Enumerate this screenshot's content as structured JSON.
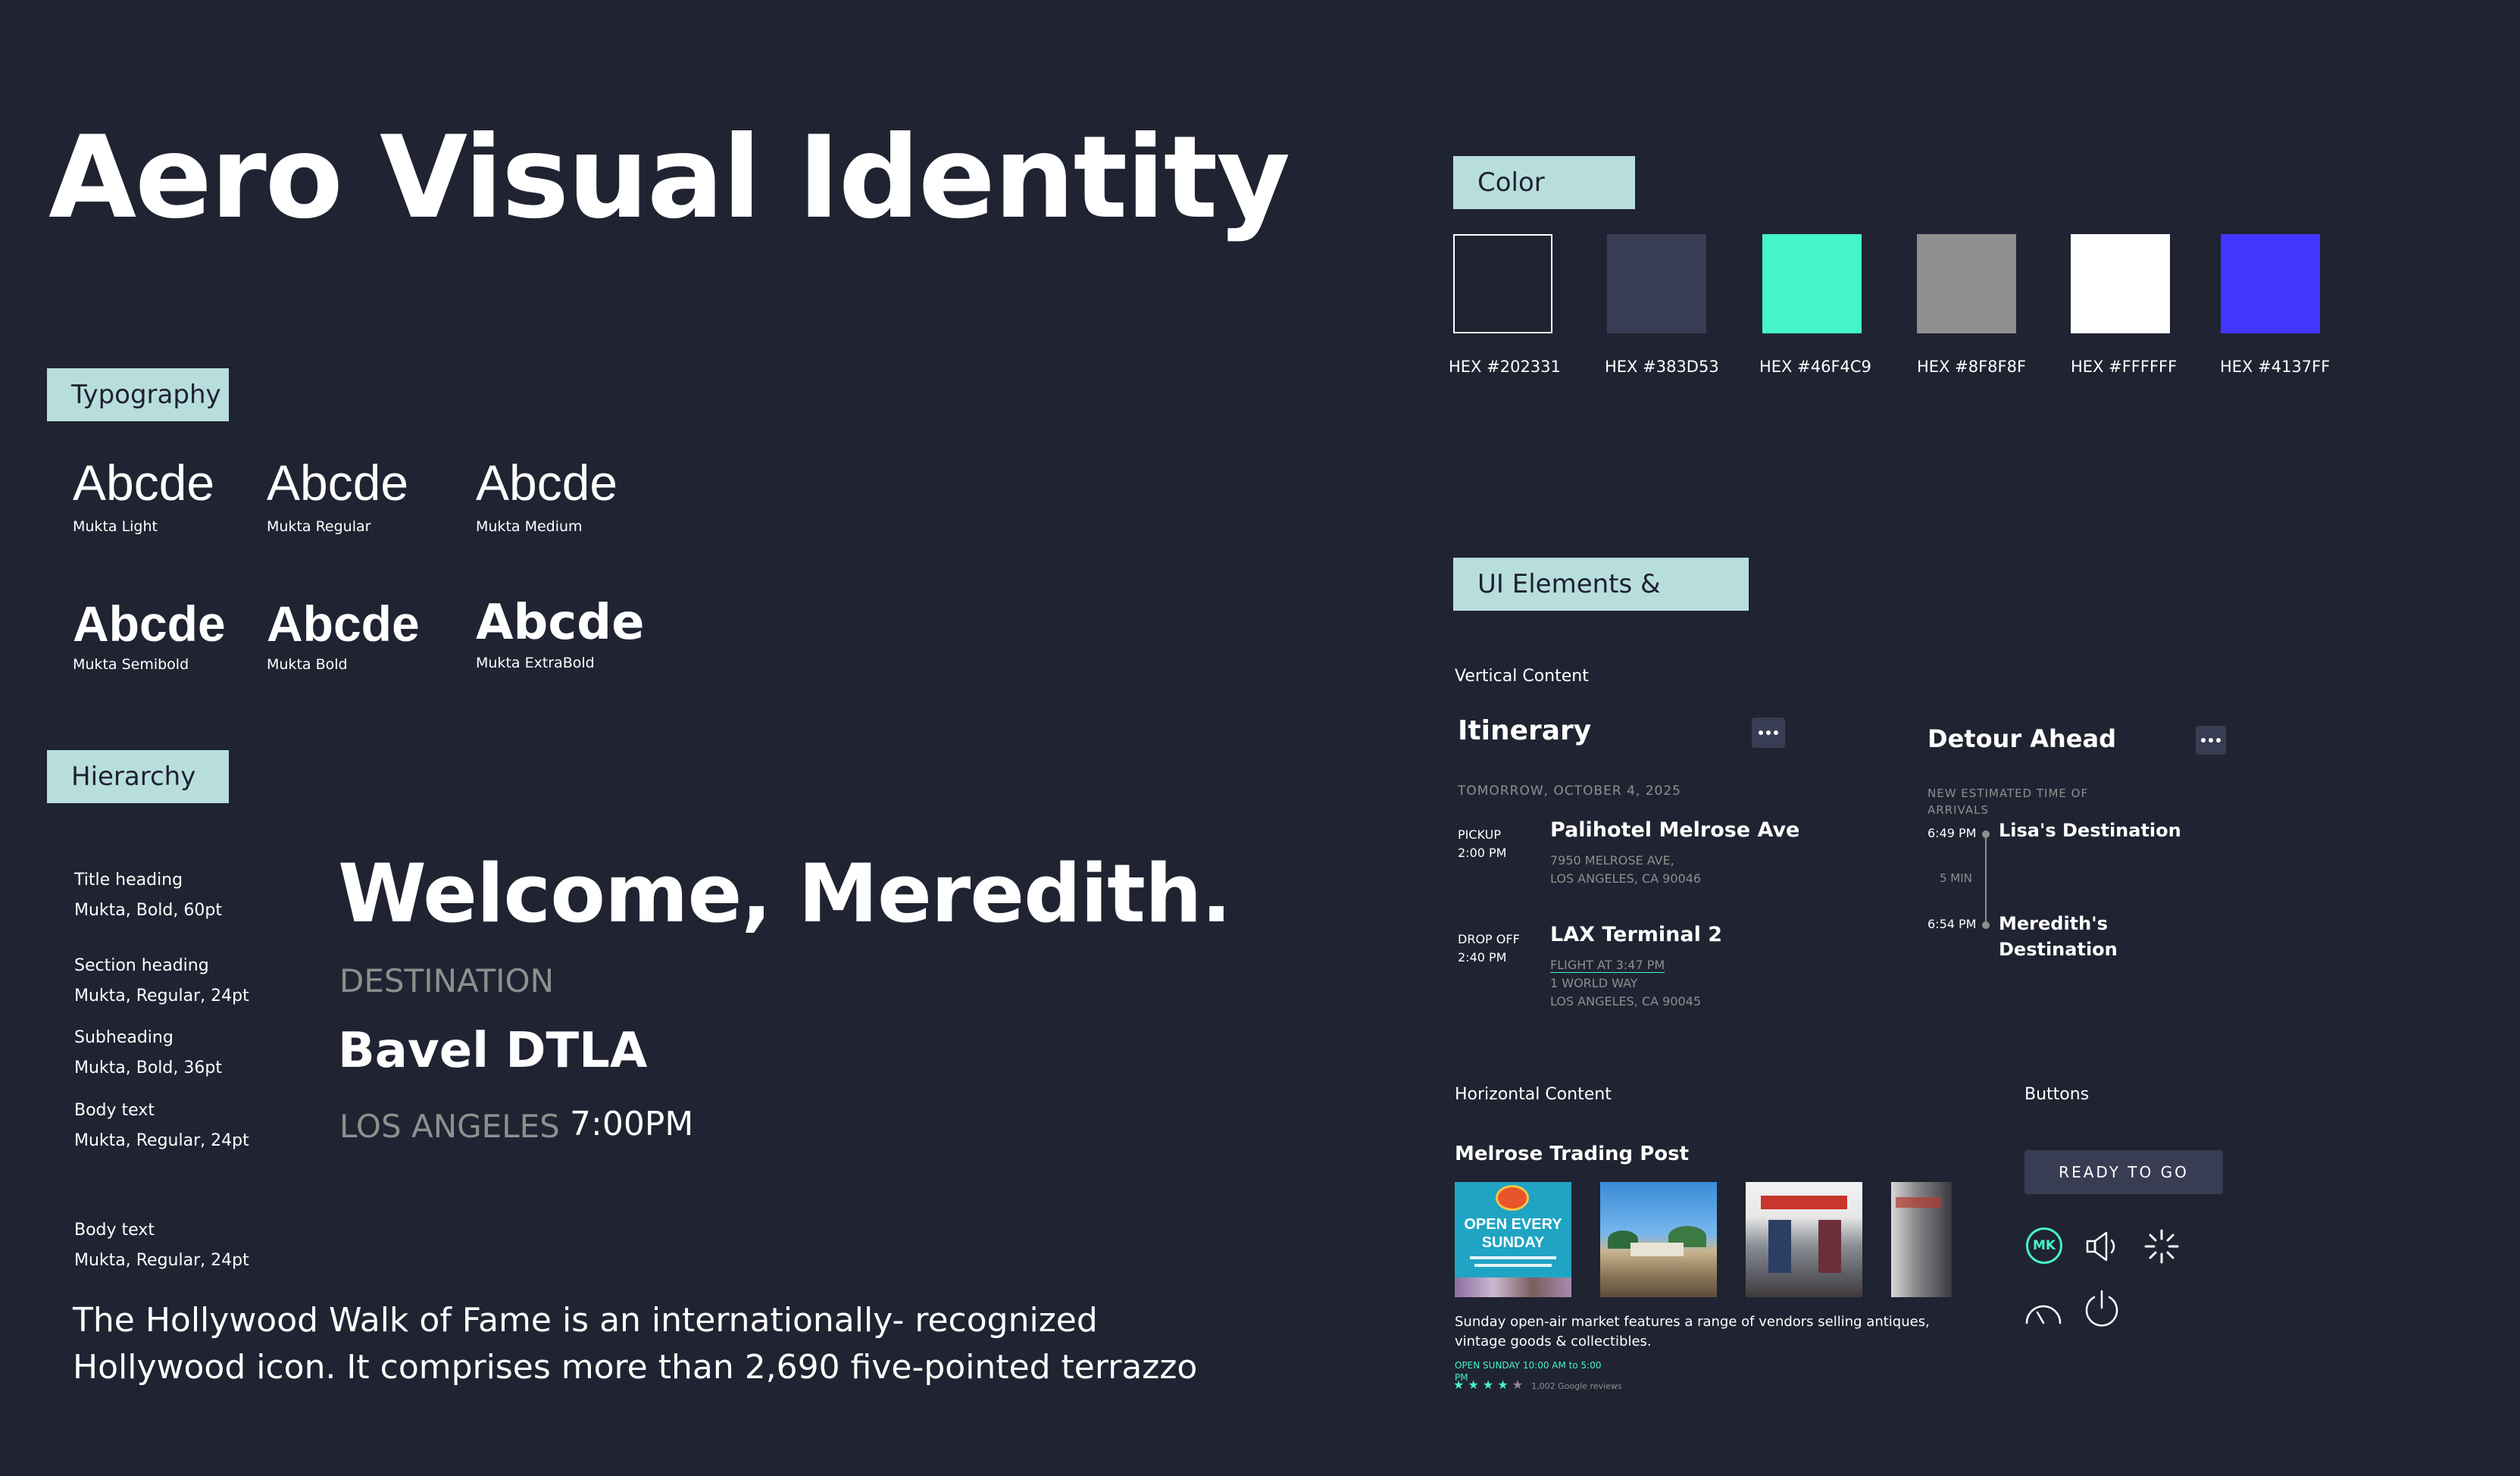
{
  "title": "Aero Visual Identity",
  "sections": {
    "typography": "Typography",
    "hierarchy": "Hierarchy",
    "color": "Color",
    "ui_elements": "UI Elements & Styling"
  },
  "typography": [
    {
      "sample": "Abcde",
      "name": "Mukta Light"
    },
    {
      "sample": "Abcde",
      "name": "Mukta Regular"
    },
    {
      "sample": "Abcde",
      "name": "Mukta Medium"
    },
    {
      "sample": "Abcde",
      "name": "Mukta Semibold"
    },
    {
      "sample": "Abcde",
      "name": "Mukta Bold"
    },
    {
      "sample": "Abcde",
      "name": "Mukta ExtraBold"
    }
  ],
  "hierarchy": {
    "labels": [
      {
        "name": "Title heading",
        "spec": "Mukta, Bold, 60pt"
      },
      {
        "name": "Section heading",
        "spec": "Mukta, Regular, 24pt"
      },
      {
        "name": "Subheading",
        "spec": "Mukta, Bold, 36pt"
      },
      {
        "name": "Body text",
        "spec": "Mukta, Regular, 24pt"
      },
      {
        "name": "Body text",
        "spec": "Mukta, Regular, 24pt"
      }
    ],
    "welcome": "Welcome, Meredith.",
    "destination_label": "DESTINATION",
    "destination_name": "Bavel DTLA",
    "city": "LOS ANGELES",
    "time": "7:00PM",
    "body_line1": "The Hollywood Walk of Fame is an internationally- recognized",
    "body_line2": "Hollywood icon. It comprises more than 2,690 five-pointed terrazzo"
  },
  "colors": [
    {
      "hex": "#202331",
      "label": "HEX  #202331"
    },
    {
      "hex": "#383D53",
      "label": "HEX  #383D53"
    },
    {
      "hex": "#46F4C9",
      "label": "HEX  #46F4C9"
    },
    {
      "hex": "#8F8F8F",
      "label": "HEX  #8F8F8F"
    },
    {
      "hex": "#FFFFFF",
      "label": "HEX  #FFFFFF"
    },
    {
      "hex": "#4137FF",
      "label": "HEX  #4137FF"
    }
  ],
  "ui": {
    "vertical_label": "Vertical Content",
    "itinerary": {
      "title": "Itinerary",
      "date": "TOMORROW, OCTOBER 4, 2025",
      "pickup_label": "PICKUP",
      "pickup_time": "2:00 PM",
      "pickup_place": "Palihotel Melrose Ave",
      "pickup_addr1": "7950 MELROSE AVE,",
      "pickup_addr2": "LOS ANGELES, CA 90046",
      "dropoff_label": "DROP OFF",
      "dropoff_time": "2:40 PM",
      "dropoff_place": "LAX Terminal 2",
      "flight_link": "FLIGHT AT 3:47 PM",
      "dropoff_addr1": "1 WORLD WAY",
      "dropoff_addr2": "LOS ANGELES, CA 90045"
    },
    "detour": {
      "title": "Detour Ahead",
      "subtitle_line1": "NEW ESTIMATED TIME OF",
      "subtitle_line2": "ARRIVALS",
      "stop1_time": "6:49 PM",
      "stop1_name": "Lisa's Destination",
      "gap": "5 MIN",
      "stop2_time": "6:54 PM",
      "stop2_name_line1": "Meredith's",
      "stop2_name_line2": "Destination"
    },
    "horizontal_label": "Horizontal Content",
    "place": {
      "name": "Melrose Trading Post",
      "poster_line1": "OPEN EVERY",
      "poster_line2": "SUNDAY",
      "desc_line1": "Sunday open-air market features a range of vendors selling antiques,",
      "desc_line2": "vintage goods & collectibles.",
      "hours_line1": "OPEN SUNDAY 10:00 AM to 5:00",
      "hours_line2": "PM",
      "rating": 4,
      "reviews": "1,002 Google reviews"
    },
    "buttons_label": "Buttons",
    "ready_button": "READY TO GO",
    "avatar_initials": "MK",
    "icons": [
      "avatar",
      "speaker-icon",
      "loading-spinner-icon",
      "gauge-icon",
      "power-icon"
    ]
  }
}
